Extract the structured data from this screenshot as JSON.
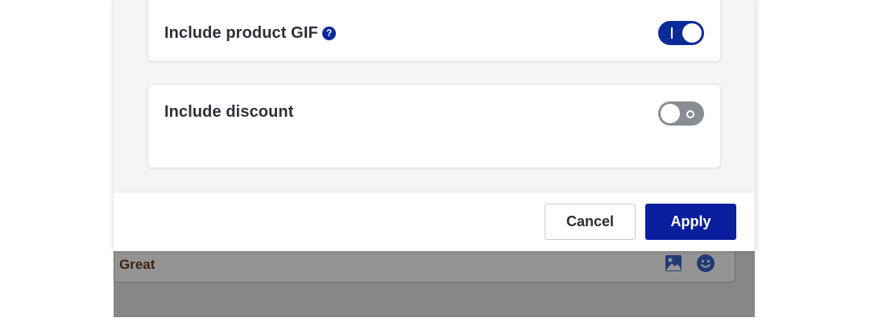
{
  "modal": {
    "options": [
      {
        "label": "Include product GIF",
        "has_help": true,
        "help_symbol": "?",
        "enabled": true,
        "toggle_mark": "on"
      },
      {
        "label": "Include discount",
        "has_help": false,
        "enabled": false,
        "toggle_mark": "off"
      }
    ],
    "footer": {
      "cancel_label": "Cancel",
      "apply_label": "Apply"
    }
  },
  "background_page": {
    "input_value": "Great",
    "icons": [
      "image-icon",
      "emoji-icon"
    ]
  },
  "colors": {
    "accent": "#0b1f9e",
    "toggle_on": "#0b2a9a",
    "toggle_off": "#8a8d93",
    "overlay": "rgba(0,0,0,0.42)"
  }
}
